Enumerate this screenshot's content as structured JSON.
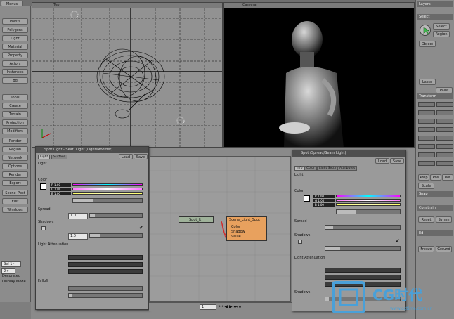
{
  "app": {
    "menu_label": "Menus"
  },
  "left_toolbar": {
    "tools": [
      "Points",
      "Polygons",
      "Light",
      "Material",
      "Property",
      "Actors",
      "Instances",
      "Bg"
    ],
    "group2": [
      "Tools",
      "Create",
      "Terrain",
      "Projection",
      "Modifiers"
    ],
    "group3": [
      "Render",
      "Region",
      "Network",
      "Options",
      "Render",
      "Export"
    ],
    "bottom": [
      "Scene_Post",
      "Edit",
      "Windows"
    ],
    "status_values": [
      "Sel 1 ·",
      "2 ▾"
    ],
    "footer": [
      "Decorated",
      "Display Mode"
    ]
  },
  "viewport_top": {
    "label": "Top"
  },
  "viewport_camera": {
    "label": "Camera"
  },
  "light_panel": {
    "title": "Spot Light - Seat: Light (Light/Modifier)",
    "tabs": [
      "Light",
      "Surface"
    ],
    "save_label": "Save",
    "load_label": "Load",
    "sections": [
      "Light",
      "Color",
      "Spread",
      "Shadows",
      "Light Attenuation",
      "Falloff"
    ],
    "channels": [
      "R  1.00",
      "G  1.00",
      "B  1.00"
    ],
    "spread_value": "1.0",
    "shadow_value": "1.0"
  },
  "node_editor": {
    "node1_label": "Spot_lt",
    "node2_title": "Scene_Light_Spot",
    "node2_ports": [
      "Color",
      "Shadow",
      "Value"
    ]
  },
  "right_panel": {
    "title": "Spot (Spread/Seam Light)",
    "tabs": [
      "Info",
      "Color",
      "Light Settings",
      "Attributes"
    ],
    "load_label": "Load",
    "save_label": "Save",
    "sections": [
      "Light",
      "Color",
      "Spread",
      "Shadows",
      "Light Attenuation",
      "Shadows"
    ],
    "channels": [
      "R  1.00",
      "G  1.00",
      "B  1.00"
    ]
  },
  "right_toolbar": {
    "headers": [
      "Layers",
      "Select",
      "Transform",
      "Snap",
      "Constrain",
      "Ed"
    ],
    "select_buttons": [
      "Select",
      "Region",
      "Lasso",
      "Paint",
      "Object"
    ],
    "bottom_buttons": [
      "Prop",
      "Pos",
      "Rot",
      "Scale",
      "Reset",
      "Symm",
      "Freeze",
      "Ground"
    ]
  },
  "timeline": {
    "frame_value": "1"
  },
  "watermark": {
    "brand": "CG时代",
    "url": "www.cgtime.com.cn"
  },
  "colors": {
    "panel_bg": "#9a9a9a",
    "node_orange": "#e8a15e",
    "node_green": "#9fb29a",
    "wire_red": "#d22b2b"
  }
}
